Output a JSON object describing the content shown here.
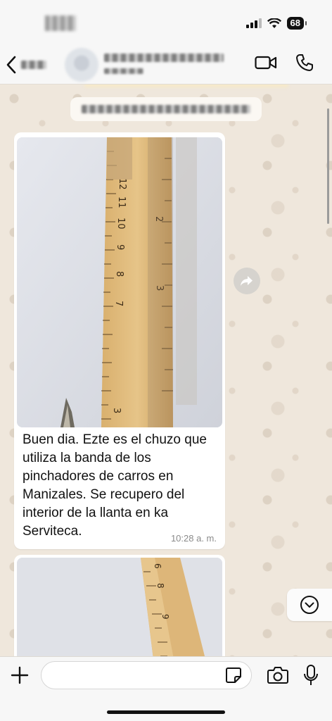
{
  "status_bar": {
    "battery": "68",
    "icons": [
      "signal-icon",
      "wifi-icon",
      "battery-icon"
    ]
  },
  "header": {
    "icons": [
      "back-chevron-icon",
      "video-call-icon",
      "phone-call-icon"
    ]
  },
  "messages": [
    {
      "caption": "Buen dia. Ezte es el chuzo que utiliza la banda de los pinchadores de carros en Manizales. Se recupero del interior de la llanta en ka Serviteca.",
      "time": "10:28 a. m."
    }
  ],
  "ruler_numbers": [
    "12",
    "11",
    "10",
    "9",
    "8",
    "7",
    "3"
  ],
  "ruler_numbers_right": [
    "2",
    "3"
  ],
  "ruler2_numbers": [
    "6",
    "8",
    "9"
  ],
  "input": {
    "placeholder": ""
  },
  "colors": {
    "chat_bg": "#efe7dc",
    "bubble_bg": "#ffffff",
    "bar_bg": "#f7f7f7"
  }
}
